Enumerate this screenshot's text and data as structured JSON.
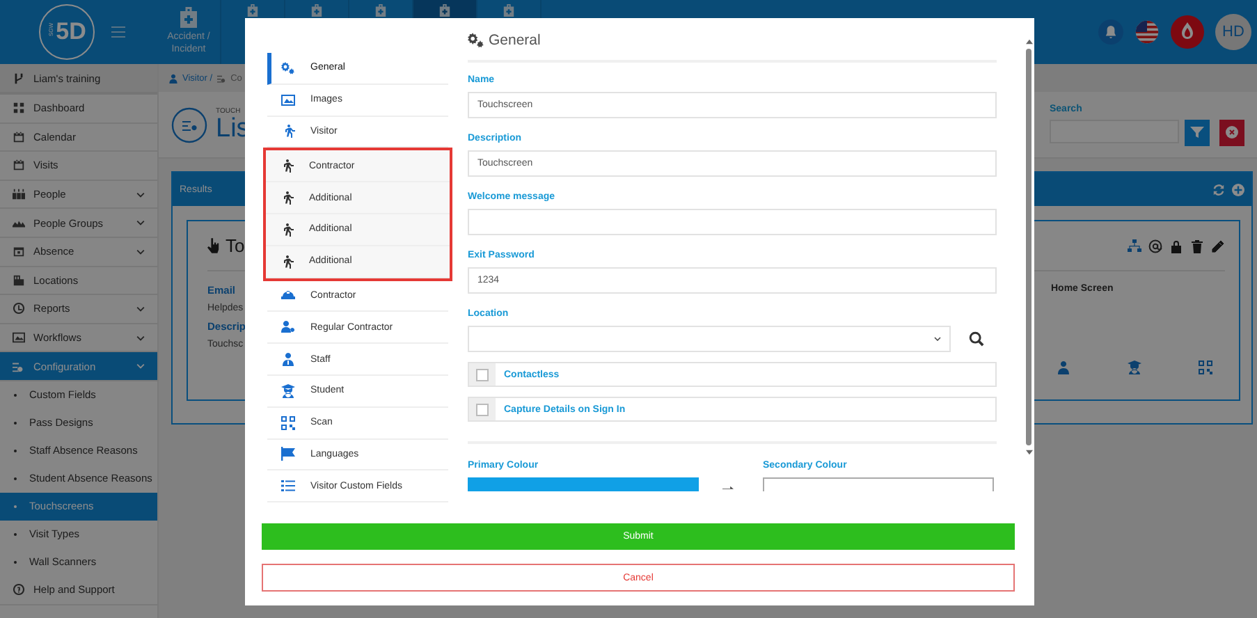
{
  "topbar": {
    "logo": "5D",
    "logo_tag": "SGW",
    "tiles": [
      {
        "label": "Accident / Incident",
        "selected": false
      },
      {
        "selected": false
      },
      {
        "selected": false
      },
      {
        "selected": false
      },
      {
        "selected": true
      },
      {
        "selected": false
      }
    ],
    "avatar": "HD"
  },
  "sidebar": {
    "workspace": "Liam's training",
    "items": [
      {
        "label": "Dashboard",
        "selected": false,
        "expandable": false
      },
      {
        "label": "Calendar",
        "selected": false,
        "expandable": false
      },
      {
        "label": "Visits",
        "selected": false,
        "expandable": false
      },
      {
        "label": "People",
        "selected": false,
        "expandable": true
      },
      {
        "label": "People Groups",
        "selected": false,
        "expandable": true
      },
      {
        "label": "Absence",
        "selected": false,
        "expandable": true
      },
      {
        "label": "Locations",
        "selected": false,
        "expandable": false
      },
      {
        "label": "Reports",
        "selected": false,
        "expandable": true
      },
      {
        "label": "Workflows",
        "selected": false,
        "expandable": true
      },
      {
        "label": "Configuration",
        "selected": true,
        "expandable": true,
        "children": [
          {
            "label": "Custom Fields",
            "selected": false
          },
          {
            "label": "Pass Designs",
            "selected": false
          },
          {
            "label": "Staff Absence Reasons",
            "selected": false
          },
          {
            "label": "Student Absence Reasons",
            "selected": false
          },
          {
            "label": "Touchscreens",
            "selected": true
          },
          {
            "label": "Visit Types",
            "selected": false
          },
          {
            "label": "Wall Scanners",
            "selected": false
          }
        ]
      },
      {
        "label": "Help and Support",
        "selected": false,
        "expandable": false
      }
    ]
  },
  "page": {
    "breadcrumb": [
      "Visitor /",
      "Co"
    ],
    "subtitle": "TOUCH",
    "title": "Lis",
    "search": {
      "label": "Search"
    },
    "results": {
      "title": "Results",
      "card": {
        "title": "To",
        "fields": [
          {
            "label": "Email",
            "value": "Helpdes"
          },
          {
            "label": "Descrip",
            "value": "Touchsc"
          }
        ],
        "column_label": "Home Screen"
      }
    }
  },
  "modal": {
    "nav": [
      {
        "highlighted": false,
        "items": [
          {
            "label": "General",
            "selected": true
          },
          {
            "label": "Images",
            "selected": false
          },
          {
            "label": "Visitor",
            "selected": false
          }
        ]
      },
      {
        "highlighted": true,
        "items": [
          {
            "label": "Contractor",
            "selected": false
          },
          {
            "label": "Additional",
            "selected": false
          },
          {
            "label": "Additional",
            "selected": false
          },
          {
            "label": "Additional",
            "selected": false
          }
        ]
      },
      {
        "highlighted": false,
        "items": [
          {
            "label": "Contractor",
            "selected": false
          },
          {
            "label": "Regular Contractor",
            "selected": false
          },
          {
            "label": "Staff",
            "selected": false
          },
          {
            "label": "Student",
            "selected": false
          },
          {
            "label": "Scan",
            "selected": false
          },
          {
            "label": "Languages",
            "selected": false
          },
          {
            "label": "Visitor Custom Fields",
            "selected": false
          }
        ]
      }
    ],
    "section_title": "General",
    "fields": [
      {
        "kind": "text",
        "label": "Name",
        "value": "Touchscreen"
      },
      {
        "kind": "text",
        "label": "Description",
        "value": "Touchscreen"
      },
      {
        "kind": "text",
        "label": "Welcome message"
      },
      {
        "kind": "text",
        "label": "Exit Password",
        "value": "1234"
      },
      {
        "kind": "select",
        "label": "Location"
      },
      {
        "kind": "checkbox",
        "label": "Contactless",
        "checked": false
      },
      {
        "kind": "checkbox",
        "label": "Capture Details on Sign In",
        "checked": false
      }
    ],
    "colours": {
      "primary": {
        "label": "Primary Colour",
        "color": "#10a0e6"
      },
      "secondary": {
        "label": "Secondary Colour"
      }
    },
    "submit": "Submit",
    "cancel": "Cancel"
  }
}
